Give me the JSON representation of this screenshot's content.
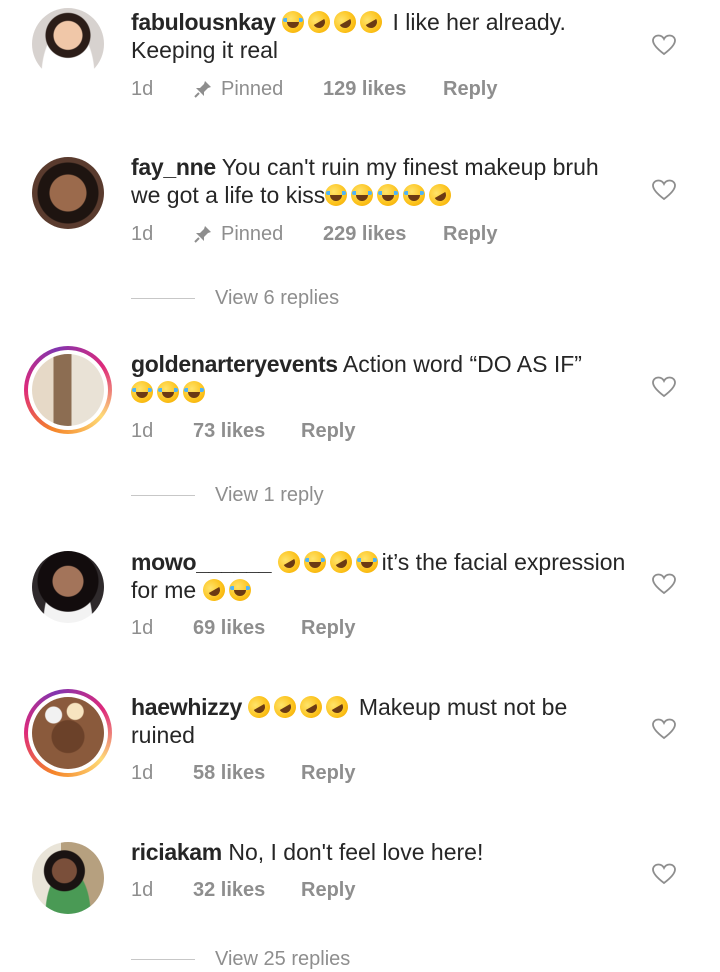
{
  "comments": [
    {
      "username": "fabulousnkay",
      "emojis_before": [
        "joy",
        "rofl",
        "rofl",
        "rofl"
      ],
      "text": " I like her already. Keeping it real",
      "emojis_after": [],
      "time": "1d",
      "pinned_label": "Pinned",
      "likes": "129 likes",
      "reply": "Reply",
      "avatar_bg": "#d7d2cf"
    },
    {
      "username": "fay_nne",
      "emojis_before": [],
      "text": " You can't ruin my finest makeup bruh we got a life to kiss",
      "emojis_after": [
        "joy",
        "joy",
        "joy",
        "joy",
        "rofl"
      ],
      "time": "1d",
      "pinned_label": "Pinned",
      "likes": "229 likes",
      "reply": "Reply",
      "avatar_bg": "#5a3b2e",
      "view_replies": "View 6 replies"
    },
    {
      "username": "goldenarteryevents",
      "emojis_before": [],
      "text": " Action word “DO AS IF”",
      "emojis_after": [
        "joy",
        "joy",
        "joy"
      ],
      "time": "1d",
      "likes": "73 likes",
      "reply": "Reply",
      "avatar_bg": "#c9b59a",
      "view_replies": "View 1 reply"
    },
    {
      "username": "mowo______",
      "emojis_before": [
        "rofl",
        "joy",
        "rofl",
        "joy"
      ],
      "text": "it’s the facial expression for me ",
      "emojis_after": [
        "rofl",
        "joy"
      ],
      "time": "1d",
      "likes": "69 likes",
      "reply": "Reply",
      "avatar_bg": "#2f2a2c"
    },
    {
      "username": "haewhizzy",
      "emojis_before": [
        "rofl",
        "rofl",
        "rofl",
        "rofl"
      ],
      "text": " Makeup must not be ruined",
      "emojis_after": [],
      "time": "1d",
      "likes": "58 likes",
      "reply": "Reply",
      "avatar_bg": "#8a5a3c"
    },
    {
      "username": "riciakam",
      "emojis_before": [],
      "text": " No, I don't feel love here!",
      "emojis_after": [],
      "time": "1d",
      "likes": "32 likes",
      "reply": "Reply",
      "avatar_bg": "#6f7a5c",
      "view_replies": "View 25 replies"
    }
  ],
  "colors": {
    "text": "#262626",
    "meta": "#8e8e8e",
    "story_ring": [
      "#f58529",
      "#dd2a7b",
      "#8134af"
    ]
  }
}
